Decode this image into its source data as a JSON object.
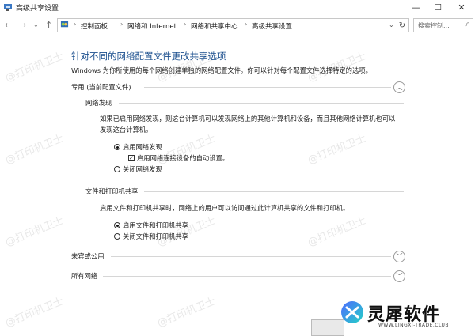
{
  "window": {
    "title": "高级共享设置"
  },
  "address": {
    "crumbs": [
      "控制面板",
      "网络和 Internet",
      "网络和共享中心",
      "高级共享设置"
    ],
    "search_placeholder": "搜索控制..."
  },
  "main": {
    "heading": "针对不同的网络配置文件更改共享选项",
    "description": "Windows 为你所使用的每个网络创建单独的网络配置文件。你可以针对每个配置文件选择特定的选项。"
  },
  "profiles": {
    "private": {
      "label": "专用 (当前配置文件)",
      "discovery": {
        "title": "网络发现",
        "text": "如果已启用网络发现，则这台计算机可以发现网络上的其他计算机和设备，而且其他网络计算机也可以发现这台计算机。",
        "opt_on": "启用网络发现",
        "opt_auto": "启用网络连接设备的自动设置。",
        "opt_off": "关闭网络发现"
      },
      "sharing": {
        "title": "文件和打印机共享",
        "text": "启用文件和打印机共享时，网络上的用户可以访问通过此计算机共享的文件和打印机。",
        "opt_on": "启用文件和打印机共享",
        "opt_off": "关闭文件和打印机共享"
      }
    },
    "guest": {
      "label": "来宾或公用"
    },
    "all": {
      "label": "所有网络"
    }
  },
  "watermark": {
    "text": "@打印机卫士"
  },
  "brand": {
    "name": "灵犀软件",
    "url": "WWW.LINGXI-TRADE.CLUB"
  },
  "colors": {
    "heading": "#1b4f8e",
    "brand_gradient": [
      "#4f6bff",
      "#22d3c5"
    ]
  },
  "state": {
    "discovery": "on",
    "auto_setup": true,
    "sharing": "on"
  }
}
